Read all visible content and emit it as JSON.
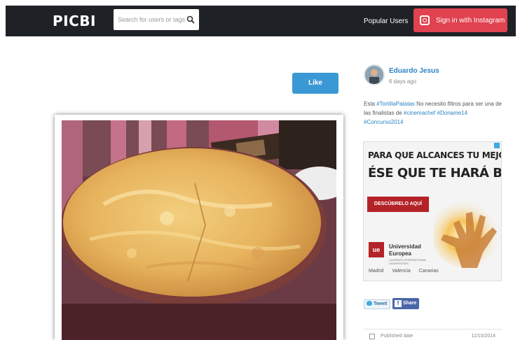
{
  "brand": {
    "logo": "PICBI"
  },
  "search": {
    "placeholder": "Search for users or tags"
  },
  "nav": {
    "popular_users": "Popular Users",
    "sign_in": "Sign in with Instagram"
  },
  "post": {
    "like_label": "Like",
    "author": "Eduardo Jesus",
    "time": "6 days ago",
    "caption_text": "Esta ",
    "caption_tag1": "#TortillaPatatas",
    "caption_mid": " No necesito filtros para ser una de las finalistas de ",
    "caption_tag2": "#cinemachef",
    "caption_tag3": "#Doname14",
    "caption_tag4": "#Concurso2014"
  },
  "ad": {
    "headline1": "PARA QUE ALCANCES TU MEJOR YO",
    "headline2": "ÉSE QUE TE HARÁ BRILLAR",
    "cta": "DESCÚBRELO AQUÍ",
    "logo_mark": "ue",
    "university": "Universidad Europea",
    "tagline": "LAUREATE INTERNATIONAL UNIVERSITIES",
    "cities": [
      "Madrid",
      "Valencia",
      "Canarias"
    ]
  },
  "share": {
    "tweet": "Tweet",
    "share": "Share"
  },
  "published": {
    "label": "Published date",
    "value": "11/10/2014"
  },
  "colors": {
    "navbar": "#1e2227",
    "instagram_button": "#e0424f",
    "like_button": "#3a98d5",
    "link": "#2a83c4",
    "facebook": "#4a66a6"
  }
}
